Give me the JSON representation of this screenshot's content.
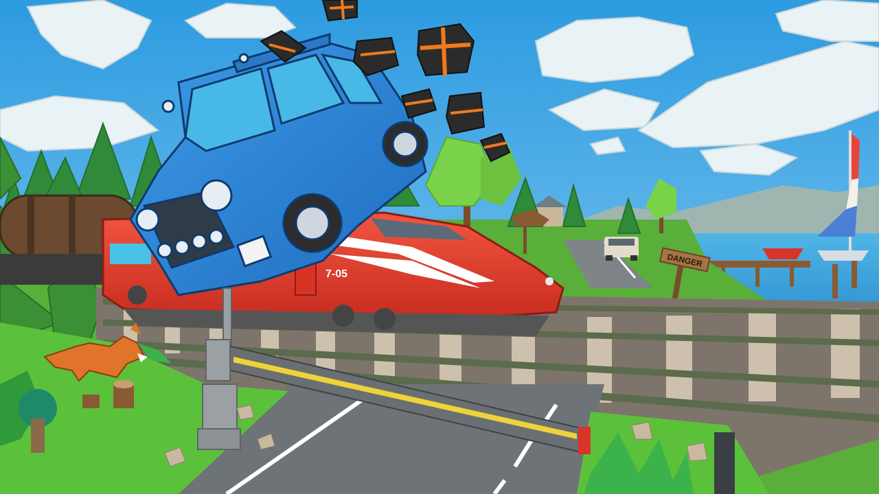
{
  "scene": {
    "train_number": "7-05",
    "danger_sign": "DANGER"
  },
  "colors": {
    "sky": "#3aa6e0",
    "grass": "#5cc13a",
    "car": "#2f86d6",
    "train": "#e23a2a",
    "crate": "#2b2b2b",
    "crate_stripe": "#f07a1e",
    "barrier_stripe": "#f0d23a"
  }
}
